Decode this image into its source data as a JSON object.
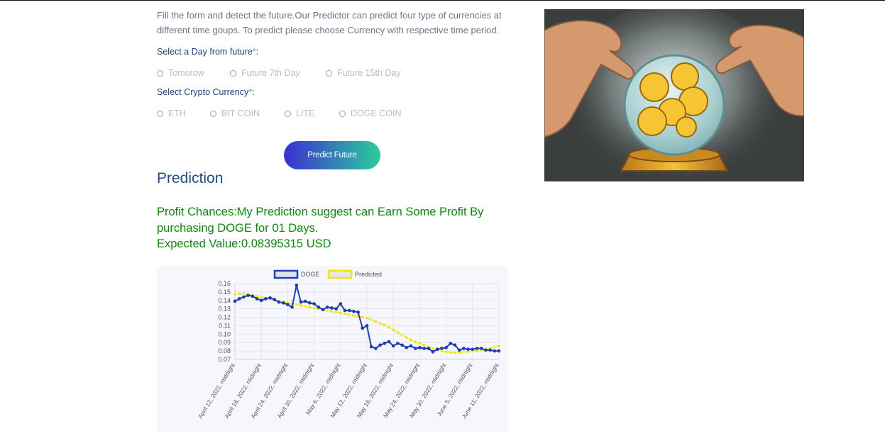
{
  "intro_text": "Fill the form and detect the future.Our Predictor can predict four type of currencies at different time goups. To predict please choose Currency with respective time period.",
  "day_label": "Select a Day from future",
  "currency_label": "Select Crypto Currency",
  "required_mark": "*",
  "colon": ":",
  "day_options": [
    "Tomorow",
    "Future 7th Day",
    "Future 15th Day"
  ],
  "currency_options": [
    "ETH",
    "BIT COIN",
    "LITE",
    "DOGE COIN"
  ],
  "predict_button": "Predict Future",
  "prediction_title": "Prediction",
  "result_line1": "Profit Chances:My Prediction suggest can Earn Some Profit By purchasing DOGE for 01 Days.",
  "result_line2": "Expected Value:0.08395315 USD",
  "hero_image": "crystal-ball-crypto-illustration",
  "chart_data": {
    "type": "line",
    "title": "",
    "xlabel": "",
    "ylabel": "",
    "ylim": [
      0.07,
      0.16
    ],
    "yticks": [
      "0.16",
      "0.15",
      "0.14",
      "0.13",
      "0.12",
      "0.11",
      "0.10",
      "0.09",
      "0.08",
      "0.07"
    ],
    "xticks": [
      "April 12, 2022, midnight",
      "April 18, 2022, midnight",
      "April 24, 2022, midnight",
      "April 30, 2022, midnight",
      "May 6, 2022, midnight",
      "May 12, 2022, midnight",
      "May 18, 2022, midnight",
      "May 24, 2022, midnight",
      "May 30, 2022, midnight",
      "June 5, 2022, midnight",
      "June 11, 2022, midnight"
    ],
    "grid": true,
    "legend": "top-center",
    "series": [
      {
        "name": "DOGE",
        "color": "#1f3fbf",
        "values": [
          0.139,
          0.142,
          0.144,
          0.146,
          0.145,
          0.142,
          0.14,
          0.142,
          0.143,
          0.141,
          0.138,
          0.137,
          0.135,
          0.132,
          0.158,
          0.138,
          0.139,
          0.137,
          0.136,
          0.132,
          0.129,
          0.132,
          0.131,
          0.13,
          0.136,
          0.128,
          0.128,
          0.127,
          0.126,
          0.107,
          0.11,
          0.085,
          0.083,
          0.087,
          0.089,
          0.091,
          0.086,
          0.089,
          0.087,
          0.084,
          0.086,
          0.083,
          0.084,
          0.083,
          0.083,
          0.079,
          0.082,
          0.083,
          0.084,
          0.089,
          0.087,
          0.081,
          0.083,
          0.082,
          0.082,
          0.083,
          0.083,
          0.081,
          0.081,
          0.08,
          0.08
        ]
      },
      {
        "name": "Predicted",
        "color": "#f2e600",
        "values": [
          0.147,
          0.148,
          0.148,
          0.147,
          0.146,
          0.145,
          0.144,
          0.143,
          0.142,
          0.14,
          0.139,
          0.138,
          0.137,
          0.136,
          0.135,
          0.134,
          0.133,
          0.132,
          0.131,
          0.13,
          0.129,
          0.128,
          0.127,
          0.126,
          0.125,
          0.124,
          0.123,
          0.122,
          0.121,
          0.12,
          0.119,
          0.117,
          0.115,
          0.113,
          0.111,
          0.108,
          0.105,
          0.102,
          0.099,
          0.096,
          0.093,
          0.091,
          0.089,
          0.087,
          0.085,
          0.083,
          0.081,
          0.08,
          0.079,
          0.078,
          0.078,
          0.078,
          0.079,
          0.079,
          0.08,
          0.08,
          0.081,
          0.082,
          0.083,
          0.085,
          0.086
        ]
      }
    ]
  }
}
